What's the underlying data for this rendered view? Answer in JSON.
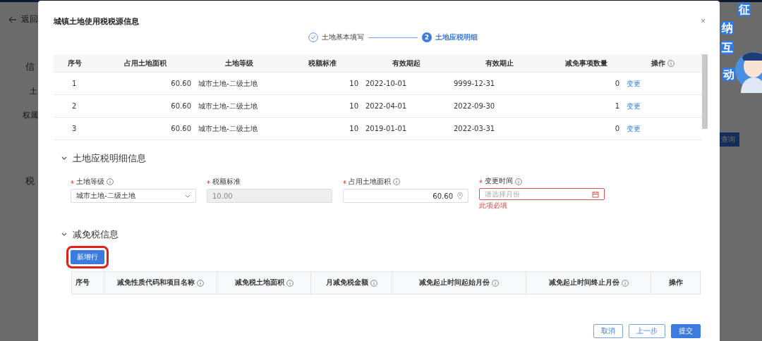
{
  "background": {
    "back_link": "返回",
    "section_1": "信",
    "field_1": "土",
    "field_2": "权属",
    "section_2": "税",
    "query_button": "查询"
  },
  "mascot": {
    "chars": [
      "征",
      "纳",
      "互",
      "动"
    ]
  },
  "dialog": {
    "title": "城镇土地使用税税源信息",
    "close": "×",
    "steps": [
      {
        "label": "土地基本填写",
        "selected": false
      },
      {
        "number": "2",
        "label": "土地应税明细",
        "selected": true
      }
    ],
    "table": {
      "columns": [
        {
          "label": "序号",
          "info": false
        },
        {
          "label": "占用土地面积",
          "info": false
        },
        {
          "label": "土地等级",
          "info": false
        },
        {
          "label": "税额标准",
          "info": false
        },
        {
          "label": "有效期起",
          "info": false
        },
        {
          "label": "有效期止",
          "info": false
        },
        {
          "label": "减免事项数量",
          "info": false
        },
        {
          "label": "操作",
          "info": true
        }
      ],
      "rows": [
        {
          "cells": [
            "1",
            "60.60",
            "城市土地-二级土地",
            "10",
            "2022-10-01",
            "9999-12-31",
            "0"
          ],
          "action": "变更"
        },
        {
          "cells": [
            "2",
            "60.60",
            "城市土地-二级土地",
            "10",
            "2022-04-01",
            "2022-09-30",
            "1"
          ],
          "action": "变更"
        },
        {
          "cells": [
            "3",
            "60.60",
            "城市土地-二级土地",
            "10",
            "2019-01-01",
            "2022-03-31",
            "0"
          ],
          "action": "变更"
        }
      ]
    },
    "detail": {
      "title": "土地应税明细信息",
      "expanded": true,
      "fields": [
        {
          "kind": "select",
          "label": "土地等级",
          "required": true,
          "info": true,
          "value": "城市土地-二级土地",
          "disabled": false
        },
        {
          "kind": "text",
          "label": "税额标准",
          "required": true,
          "info": false,
          "value": "10.00",
          "disabled": true
        },
        {
          "kind": "number",
          "label": "占用土地面积",
          "required": true,
          "info": true,
          "value": "60.60",
          "disabled": false
        },
        {
          "kind": "month",
          "label": "变更时间",
          "required": true,
          "info": true,
          "placeholder": "请选择月份",
          "error": "此项必填",
          "disabled": false
        }
      ]
    },
    "relief": {
      "title": "减免税信息",
      "expanded": true,
      "add_button": "新增行",
      "highlighted": true,
      "columns": [
        {
          "label": "序号",
          "info": false
        },
        {
          "label": "减免性质代码和项目名称",
          "info": true
        },
        {
          "label": "减免税土地面积",
          "info": true
        },
        {
          "label": "月减免税金额",
          "info": true
        },
        {
          "label": "减免起止时间起始月份",
          "info": true
        },
        {
          "label": "减免起止时间终止月份",
          "info": true
        },
        {
          "label": "操作",
          "info": false
        }
      ]
    },
    "footer": [
      {
        "label": "取消",
        "kind": "outline"
      },
      {
        "label": "上一步",
        "kind": "outline"
      },
      {
        "label": "提交",
        "kind": "primary"
      }
    ]
  }
}
